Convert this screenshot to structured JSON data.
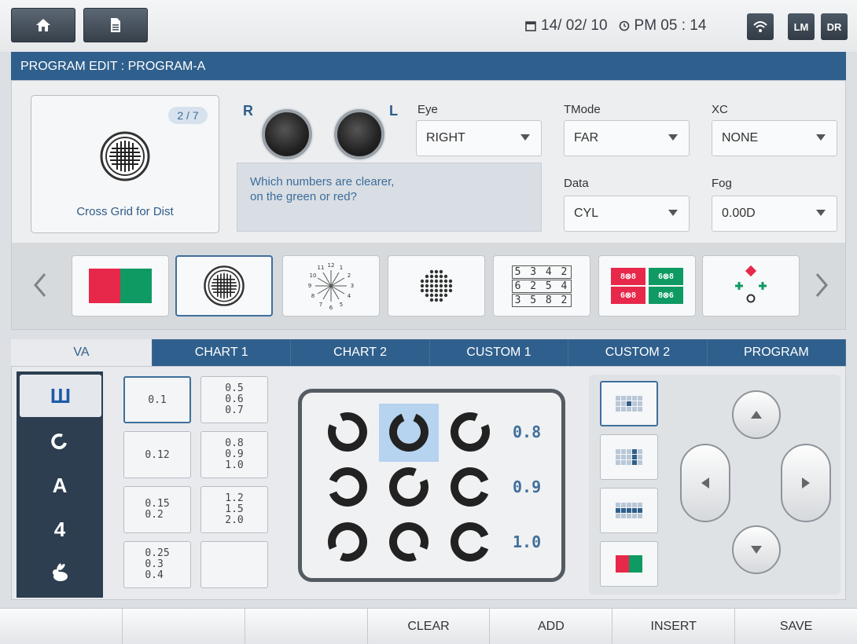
{
  "topbar": {
    "home_icon": "home-icon",
    "doc_icon": "document-icon",
    "date": "14/ 02/ 10",
    "time": "PM  05 : 14",
    "wifi_icon": "wifi-icon",
    "lm": "LM",
    "dr": "DR"
  },
  "program_edit": {
    "title": "PROGRAM EDIT :  PROGRAM-A",
    "test": {
      "counter": "2 / 7",
      "name": "Cross Grid for Dist"
    },
    "eyes": {
      "right": "R",
      "left": "L"
    },
    "question": "Which numbers are clearer,\non the green or red?",
    "fields": {
      "eye": {
        "label": "Eye",
        "value": "RIGHT"
      },
      "tmode": {
        "label": "TMode",
        "value": "FAR"
      },
      "xc": {
        "label": "XC",
        "value": "NONE"
      },
      "data": {
        "label": "Data",
        "value": "CYL"
      },
      "fog": {
        "label": "Fog",
        "value": "0.00D"
      }
    },
    "chart_tiles": [
      {
        "name": "red-green-icon"
      },
      {
        "name": "cross-grid-icon",
        "selected": true
      },
      {
        "name": "astigmatic-clock-icon"
      },
      {
        "name": "dot-cluster-icon"
      },
      {
        "name": "number-chart-icon",
        "rows": [
          "5 3 4 2",
          "6 2 5 4",
          "3 5 8 2"
        ]
      },
      {
        "name": "red-green-number-icon",
        "cells": [
          "8⊗8",
          "6⊗8",
          "6⊗8",
          "8⊗6"
        ]
      },
      {
        "name": "worth-four-dot-icon"
      }
    ]
  },
  "tabs": [
    "VA",
    "CHART 1",
    "CHART 2",
    "CUSTOM 1",
    "CUSTOM 2",
    "PROGRAM"
  ],
  "optotypes": [
    "Ш",
    "O",
    "A",
    "4",
    "rabbit-icon"
  ],
  "va_buttons": [
    [
      "0.1"
    ],
    [
      "0.5",
      "0.6",
      "0.7"
    ],
    [
      "0.12"
    ],
    [
      "0.8",
      "0.9",
      "1.0"
    ],
    [
      "0.15",
      "0.2"
    ],
    [
      "1.2",
      "1.5",
      "2.0"
    ],
    [
      "0.25",
      "0.3",
      "0.4"
    ],
    []
  ],
  "display": {
    "rows": [
      "0.8",
      "0.9",
      "1.0"
    ]
  },
  "bottom": [
    "",
    "",
    "",
    "CLEAR",
    "ADD",
    "INSERT",
    "SAVE"
  ]
}
